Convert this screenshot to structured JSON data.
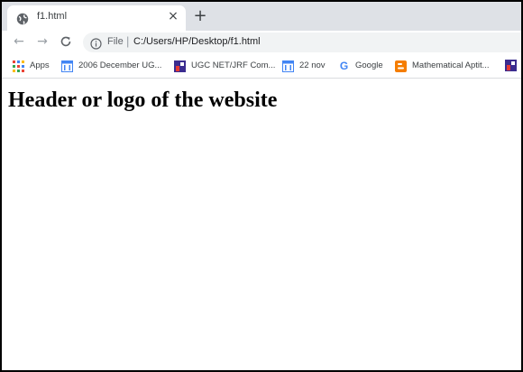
{
  "browser": {
    "tab": {
      "title": "f1.html",
      "close_glyph": "×"
    },
    "new_tab_glyph": "+",
    "nav": {
      "back_glyph": "←",
      "forward_glyph": "→",
      "reload_glyph": "C"
    },
    "omnibox": {
      "scheme_label": "File",
      "separator": "|",
      "url": "C:/Users/HP/Desktop/f1.html"
    },
    "bookmarks": [
      {
        "label": "Apps",
        "icon": "apps-grid-icon"
      },
      {
        "label": "2006 December UG...",
        "icon": "google-docs-icon"
      },
      {
        "label": "UGC NET/JRF Com...",
        "icon": "site-favicon-icon"
      },
      {
        "label": "22 nov",
        "icon": "google-docs-icon"
      },
      {
        "label": "Google",
        "icon": "google-g-icon"
      },
      {
        "label": "Mathematical Aptit...",
        "icon": "blogger-icon"
      }
    ]
  },
  "page": {
    "heading": "Header or logo of the website"
  },
  "colors": {
    "tabstrip": "#dee1e6",
    "omnibox": "#f1f3f4",
    "accent_blue": "#4285f4",
    "blogger_orange": "#f57d00"
  }
}
